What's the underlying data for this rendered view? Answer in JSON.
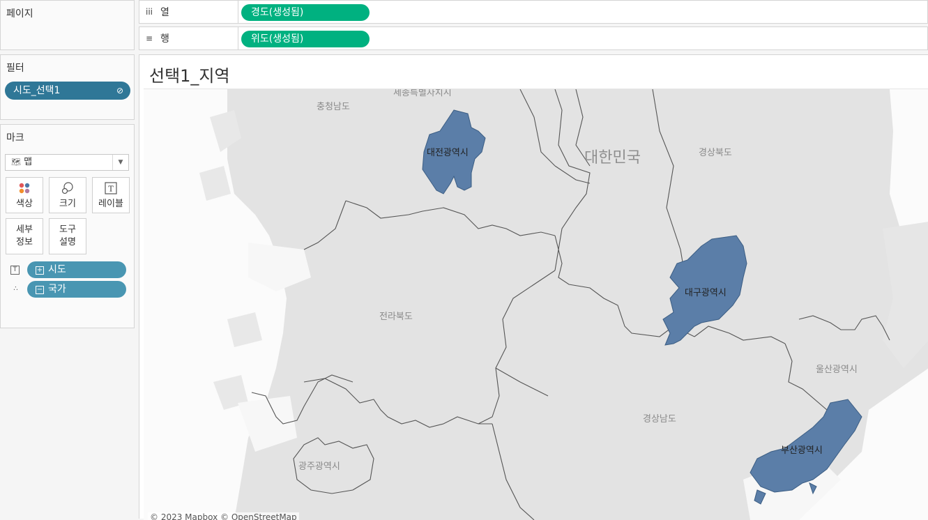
{
  "pages": {
    "title": "페이지"
  },
  "columns": {
    "icon": "iii",
    "label": "열",
    "pill": "경도(생성됨)"
  },
  "rows": {
    "icon": "≡",
    "label": "행",
    "pill": "위도(생성됨)"
  },
  "filters": {
    "title": "필터",
    "pill": "시도_선택1",
    "pill_icon": "link-icon"
  },
  "marks": {
    "title": "마크",
    "type": {
      "icon": "map-icon",
      "label": "맵"
    },
    "buttons": {
      "color": "색상",
      "size": "크기",
      "label": "레이블",
      "detail_line1": "세부",
      "detail_line2": "정보",
      "tooltip_line1": "도구",
      "tooltip_line2": "설명"
    },
    "fields": [
      {
        "icon": "label-icon",
        "toggle": "⊞",
        "name": "시도"
      },
      {
        "icon": "detail-icon",
        "toggle": "⊟",
        "name": "국가"
      }
    ]
  },
  "view": {
    "title": "선택1_지역",
    "attribution": "© 2023 Mapbox © OpenStreetMap"
  },
  "map": {
    "country": "대한민국",
    "base_labels": [
      "충청남도",
      "세종특별자치시",
      "경상북도",
      "전라북도",
      "울산광역시",
      "경상남도",
      "광주광역시"
    ],
    "highlighted_regions": [
      "대전광역시",
      "대구광역시",
      "부산광역시"
    ],
    "colors": {
      "highlight": "#5b7ea8",
      "land": "#e3e3e3",
      "sea": "#fbfbfb",
      "pill_green": "#00b180",
      "pill_blue": "#4996b2"
    }
  }
}
